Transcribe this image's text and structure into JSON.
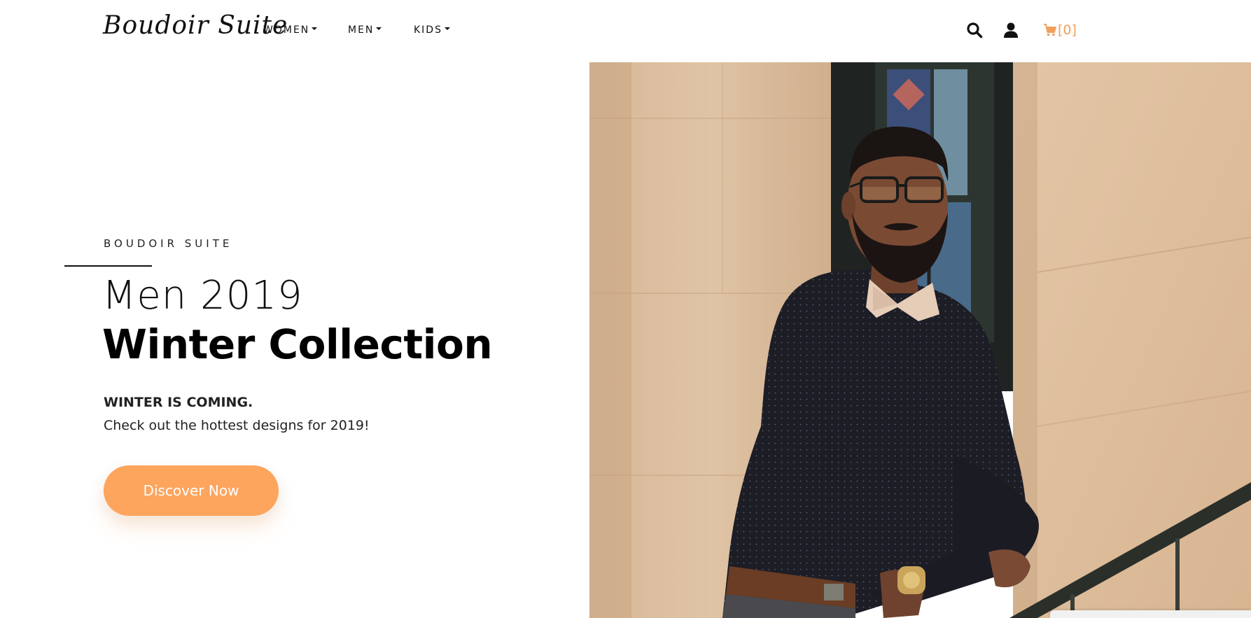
{
  "header": {
    "logo": "Boudoir Suite",
    "nav": [
      {
        "label": "WOMEN"
      },
      {
        "label": "MEN"
      },
      {
        "label": "KIDS"
      }
    ],
    "icons": {
      "search": "search-icon",
      "account": "user-icon",
      "cart": "cart-icon"
    },
    "cart_count": "[0]"
  },
  "hero": {
    "eyebrow": "BOUDOIR SUITE",
    "title_line1": "Men 2019",
    "title_line2": "Winter Collection",
    "subheading": "WINTER IS COMING.",
    "description": "Check out the hottest designs for 2019!",
    "cta_label": "Discover Now",
    "image": "man-in-glasses-and-bow-tie-leaning-on-railing"
  },
  "colors": {
    "accent": "#fda45d",
    "cart": "#f0a05c",
    "text": "#111111"
  }
}
